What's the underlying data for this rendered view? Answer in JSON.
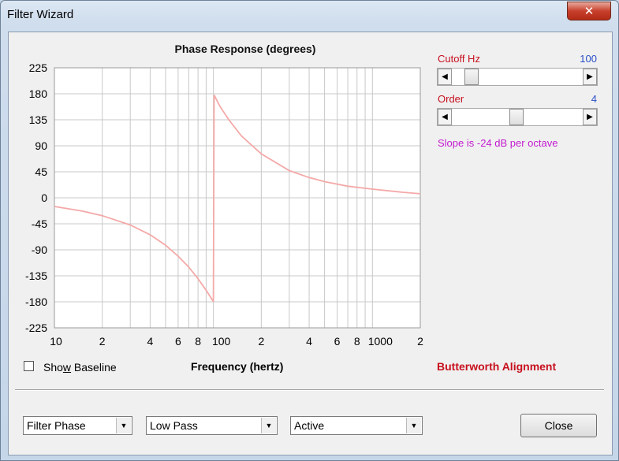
{
  "window": {
    "title": "Filter Wizard",
    "close_glyph": "✕"
  },
  "chart_data": {
    "type": "line",
    "title": "Phase Response (degrees)",
    "xlabel": "Frequency (hertz)",
    "ylabel": "",
    "xscale": "log",
    "xlim": [
      10,
      2000
    ],
    "ylim": [
      -225,
      225
    ],
    "yticks": [
      225,
      180,
      135,
      90,
      45,
      0,
      -45,
      -90,
      -135,
      -180,
      -225
    ],
    "ytick_labels": [
      "225",
      "180",
      "135",
      "90",
      "45",
      "0",
      "-45",
      "-90",
      "-135",
      "-180",
      "-225"
    ],
    "xtick_labels": [
      {
        "value": 10,
        "label": "10"
      },
      {
        "value": 20,
        "label": "2"
      },
      {
        "value": 40,
        "label": "4"
      },
      {
        "value": 60,
        "label": "6"
      },
      {
        "value": 80,
        "label": "8"
      },
      {
        "value": 100,
        "label": "100"
      },
      {
        "value": 200,
        "label": "2"
      },
      {
        "value": 400,
        "label": "4"
      },
      {
        "value": 600,
        "label": "6"
      },
      {
        "value": 800,
        "label": "8"
      },
      {
        "value": 1000,
        "label": "1000"
      },
      {
        "value": 2000,
        "label": "2"
      }
    ],
    "grid": true,
    "series": [
      {
        "color": "#f4a9a8",
        "x": [
          10,
          15,
          20,
          30,
          40,
          50,
          60,
          70,
          80,
          90,
          99,
          100,
          101,
          110,
          125,
          150,
          200,
          300,
          400,
          500,
          700,
          1000,
          1500,
          2000
        ],
        "y": [
          -15,
          -23,
          -31,
          -47,
          -64,
          -82,
          -101,
          -120,
          -140,
          -160,
          -178,
          -180,
          178,
          158,
          135,
          107,
          76,
          47,
          35,
          28,
          20,
          15,
          10,
          7
        ]
      }
    ]
  },
  "cutoff": {
    "label": "Cutoff  Hz",
    "value": "100",
    "slider_fraction": 0.11
  },
  "order": {
    "label": "Order",
    "value": "4",
    "slider_fraction": 0.49
  },
  "slope_text": "Slope is -24 dB per octave",
  "show_baseline": {
    "label_pre": "Sho",
    "label_accel": "w",
    "label_post": " Baseline",
    "checked": false
  },
  "alignment_text": "Butterworth Alignment",
  "dropdowns": {
    "display": "Filter Phase",
    "type": "Low Pass",
    "mode": "Active"
  },
  "close_button": "Close",
  "colors": {
    "curve": "#f4a9a8",
    "grid": "#c8c8c8",
    "value_blue": "#2a4fc9",
    "label_red": "#c7101e",
    "slope_magenta": "#c31bd0"
  }
}
